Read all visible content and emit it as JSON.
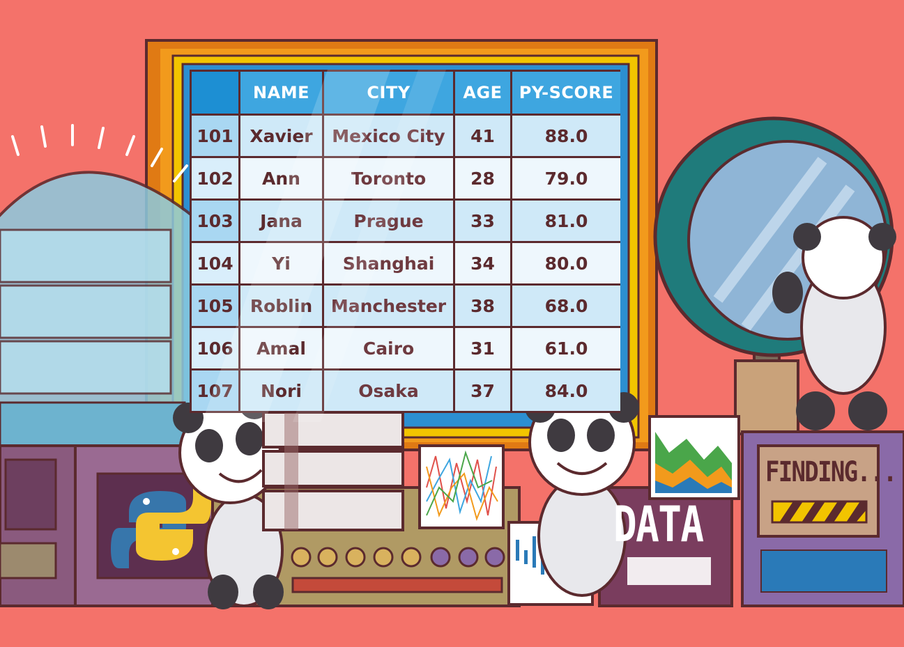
{
  "table": {
    "headers": [
      "",
      "NAME",
      "CITY",
      "AGE",
      "PY-SCORE"
    ],
    "rows": [
      [
        "101",
        "Xavier",
        "Mexico City",
        "41",
        "88.0"
      ],
      [
        "102",
        "Ann",
        "Toronto",
        "28",
        "79.0"
      ],
      [
        "103",
        "Jana",
        "Prague",
        "33",
        "81.0"
      ],
      [
        "104",
        "Yi",
        "Shanghai",
        "34",
        "80.0"
      ],
      [
        "105",
        "Roblin",
        "Manchester",
        "38",
        "68.0"
      ],
      [
        "106",
        "Amal",
        "Cairo",
        "31",
        "61.0"
      ],
      [
        "107",
        "Nori",
        "Osaka",
        "37",
        "84.0"
      ]
    ]
  },
  "signs": {
    "finding": "FINDING...",
    "data": "DATA"
  },
  "colors": {
    "background": "#f4726a",
    "outline": "#5b2a2e",
    "header_blue": "#3ea6e0",
    "frame_yellow": "#f2c400"
  },
  "icons": [
    "python-logo",
    "panda-mascot",
    "database-icon",
    "magnifying-glass",
    "line-chart-card",
    "area-chart-card",
    "bar-chart-card"
  ]
}
